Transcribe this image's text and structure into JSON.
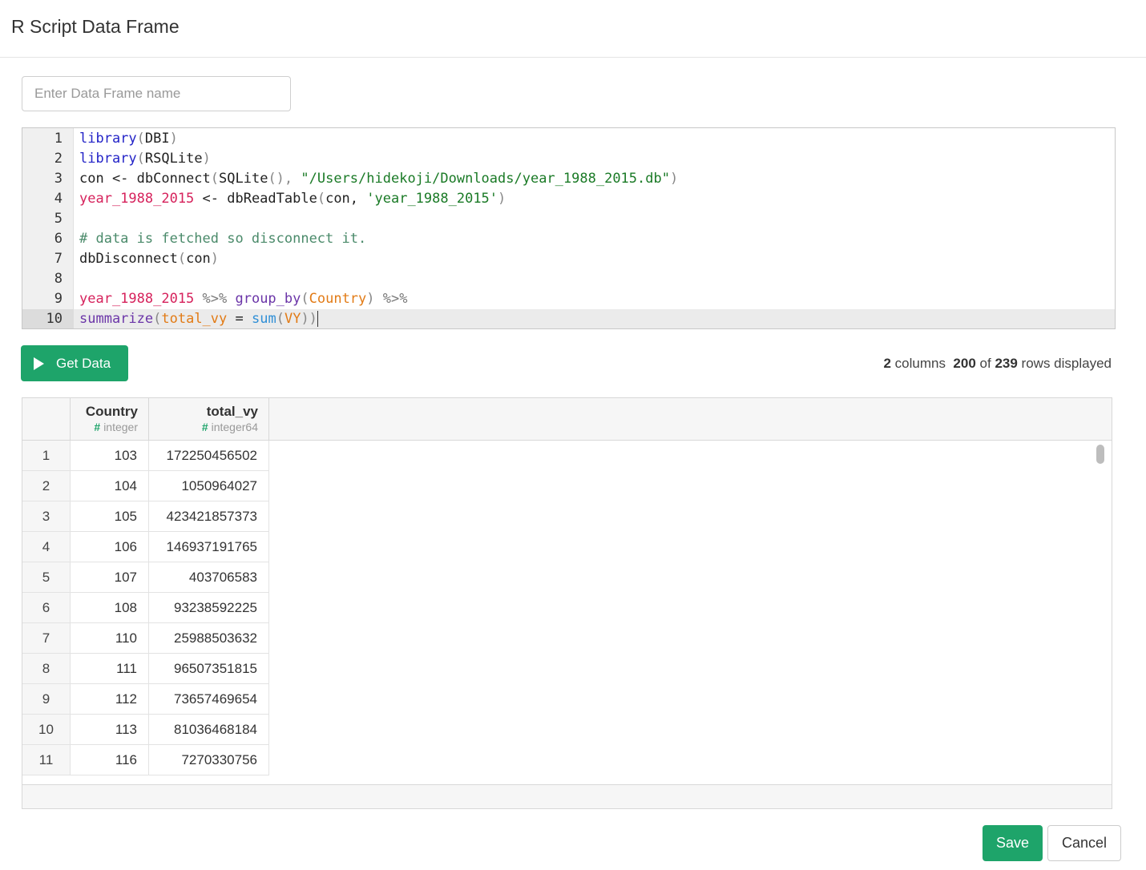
{
  "dialog": {
    "title": "R Script Data Frame"
  },
  "name_input": {
    "placeholder": "Enter Data Frame name",
    "value": ""
  },
  "editor": {
    "active_line": 10,
    "lines": [
      {
        "n": "1",
        "tokens": [
          {
            "t": "library",
            "c": "kw"
          },
          {
            "t": "(",
            "c": "paren"
          },
          {
            "t": "DBI",
            "c": ""
          },
          {
            "t": ")",
            "c": "paren"
          }
        ]
      },
      {
        "n": "2",
        "tokens": [
          {
            "t": "library",
            "c": "kw"
          },
          {
            "t": "(",
            "c": "paren"
          },
          {
            "t": "RSQLite",
            "c": ""
          },
          {
            "t": ")",
            "c": "paren"
          }
        ]
      },
      {
        "n": "3",
        "tokens": [
          {
            "t": "con <- dbConnect",
            "c": ""
          },
          {
            "t": "(",
            "c": "paren"
          },
          {
            "t": "SQLite",
            "c": ""
          },
          {
            "t": "(), ",
            "c": "paren"
          },
          {
            "t": "\"/Users/hidekoji/Downloads/year_1988_2015.db\"",
            "c": "str"
          },
          {
            "t": ")",
            "c": "paren"
          }
        ]
      },
      {
        "n": "4",
        "tokens": [
          {
            "t": "year_1988_2015",
            "c": "var"
          },
          {
            "t": " <- dbReadTable",
            "c": ""
          },
          {
            "t": "(",
            "c": "paren"
          },
          {
            "t": "con, ",
            "c": ""
          },
          {
            "t": "'year_1988_2015'",
            "c": "str"
          },
          {
            "t": ")",
            "c": "paren"
          }
        ]
      },
      {
        "n": "5",
        "tokens": []
      },
      {
        "n": "6",
        "tokens": [
          {
            "t": "# data is fetched so disconnect it.",
            "c": "cmt"
          }
        ]
      },
      {
        "n": "7",
        "tokens": [
          {
            "t": "dbDisconnect",
            "c": ""
          },
          {
            "t": "(",
            "c": "paren"
          },
          {
            "t": "con",
            "c": ""
          },
          {
            "t": ")",
            "c": "paren"
          }
        ]
      },
      {
        "n": "8",
        "tokens": []
      },
      {
        "n": "9",
        "tokens": [
          {
            "t": "year_1988_2015",
            "c": "var"
          },
          {
            "t": " %>% ",
            "c": "op"
          },
          {
            "t": "group_by",
            "c": "fn"
          },
          {
            "t": "(",
            "c": "paren"
          },
          {
            "t": "Country",
            "c": "arg"
          },
          {
            "t": ")",
            "c": "paren"
          },
          {
            "t": " %>%",
            "c": "op"
          }
        ]
      },
      {
        "n": "10",
        "tokens": [
          {
            "t": "summarize",
            "c": "fn"
          },
          {
            "t": "(",
            "c": "paren"
          },
          {
            "t": "total_vy",
            "c": "arg"
          },
          {
            "t": " = ",
            "c": ""
          },
          {
            "t": "sum",
            "c": "sum"
          },
          {
            "t": "(",
            "c": "paren"
          },
          {
            "t": "VY",
            "c": "arg"
          },
          {
            "t": "))",
            "c": "paren"
          }
        ]
      }
    ]
  },
  "toolbar": {
    "get_data_label": "Get Data",
    "play_icon": "play-icon"
  },
  "summary": {
    "columns": "2",
    "columns_label": "columns",
    "shown": "200",
    "of_label": "of",
    "total": "239",
    "rows_label": "rows displayed"
  },
  "table": {
    "columns": [
      {
        "name": "Country",
        "type": "integer"
      },
      {
        "name": "total_vy",
        "type": "integer64"
      }
    ],
    "type_icon": "#",
    "rows": [
      [
        "1",
        "103",
        "172250456502"
      ],
      [
        "2",
        "104",
        "1050964027"
      ],
      [
        "3",
        "105",
        "423421857373"
      ],
      [
        "4",
        "106",
        "146937191765"
      ],
      [
        "5",
        "107",
        "403706583"
      ],
      [
        "6",
        "108",
        "93238592225"
      ],
      [
        "7",
        "110",
        "25988503632"
      ],
      [
        "8",
        "111",
        "96507351815"
      ],
      [
        "9",
        "112",
        "73657469654"
      ],
      [
        "10",
        "113",
        "81036468184"
      ],
      [
        "11",
        "116",
        "7270330756"
      ]
    ]
  },
  "footer": {
    "save_label": "Save",
    "cancel_label": "Cancel"
  },
  "colors": {
    "accent": "#1ea46a"
  }
}
